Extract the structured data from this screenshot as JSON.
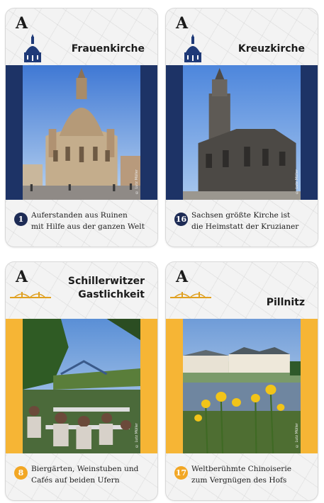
{
  "cards": [
    {
      "letter": "A",
      "title": "Frauenkirche",
      "number": "1",
      "desc_line1": "Auferstanden aus Ruinen",
      "desc_line2": "mit Hilfe aus der ganzen Welt",
      "copyright": "© Lutz Müller"
    },
    {
      "letter": "A",
      "title": "Kreuzkirche",
      "number": "16",
      "desc_line1": "Sachsen größte Kirche ist",
      "desc_line2": "die Heimstatt der Kruzianer",
      "copyright": "© Lutz Müller"
    },
    {
      "letter": "A",
      "title_line1": "Schillerwitzer",
      "title_line2": "Gastlichkeit",
      "number": "8",
      "desc_line1": "Biergärten, Weinstuben und",
      "desc_line2": "Cafés auf beiden Ufern",
      "copyright": "© Lutz Müller"
    },
    {
      "letter": "A",
      "title": "Pillnitz",
      "number": "17",
      "desc_line1": "Weltberühmte Chinoiserie",
      "desc_line2": "zum Vergnügen des Hofs",
      "copyright": "© Lutz Müller"
    }
  ],
  "colors": {
    "navy": "#1d3366",
    "orange": "#f6b535"
  }
}
